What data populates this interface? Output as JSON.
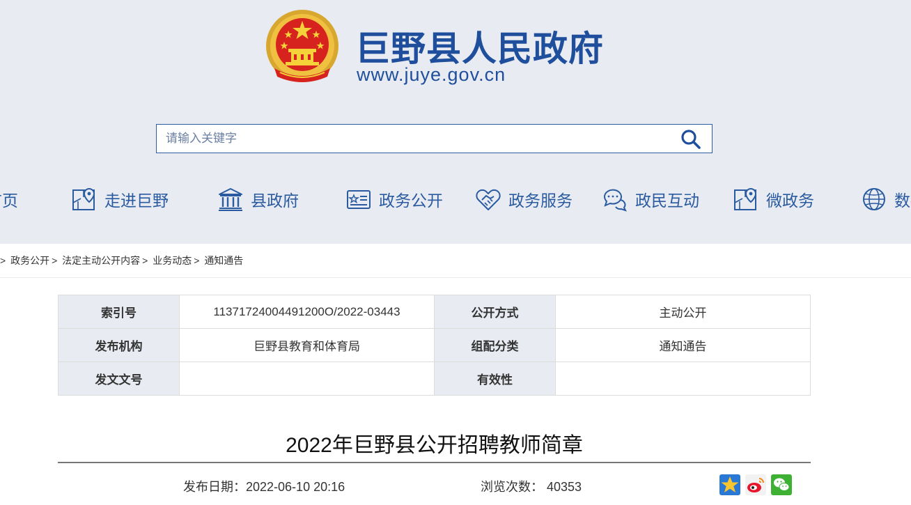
{
  "header": {
    "site_name": "巨野县人民政府",
    "site_url": "www.juye.gov.cn"
  },
  "search": {
    "placeholder": "请输入关键字"
  },
  "nav": {
    "items": [
      {
        "label": "首页",
        "icon": "home-icon"
      },
      {
        "label": "走进巨野",
        "icon": "map-pin-icon"
      },
      {
        "label": "县政府",
        "icon": "government-building-icon"
      },
      {
        "label": "政务公开",
        "icon": "document-card-icon"
      },
      {
        "label": "政务服务",
        "icon": "handshake-heart-icon"
      },
      {
        "label": "政民互动",
        "icon": "chat-bubbles-icon"
      },
      {
        "label": "微政务",
        "icon": "map-pin-icon"
      },
      {
        "label": "数据",
        "icon": "globe-icon"
      }
    ]
  },
  "breadcrumb": {
    "items": [
      "政务公开",
      "法定主动公开内容",
      "业务动态",
      "通知通告"
    ],
    "separator": ">"
  },
  "meta": {
    "index_no_label": "索引号",
    "index_no": "11371724004491200O/2022-03443",
    "publish_method_label": "公开方式",
    "publish_method": "主动公开",
    "issuer_label": "发布机构",
    "issuer": "巨野县教育和体育局",
    "category_label": "组配分类",
    "category": "通知通告",
    "doc_no_label": "发文文号",
    "doc_no": "",
    "validity_label": "有效性",
    "validity": ""
  },
  "article": {
    "title": "2022年巨野县公开招聘教师简章",
    "date_label": "发布日期：",
    "date": "2022-06-10 20:16",
    "views_label": "浏览次数：",
    "views": "40353"
  },
  "share": {
    "items": [
      "qzone-icon",
      "weibo-icon",
      "wechat-icon"
    ]
  },
  "colors": {
    "brand_blue": "#1f4f9c",
    "header_bg": "#e8ecf2",
    "nav_text": "#2a5aa0"
  }
}
